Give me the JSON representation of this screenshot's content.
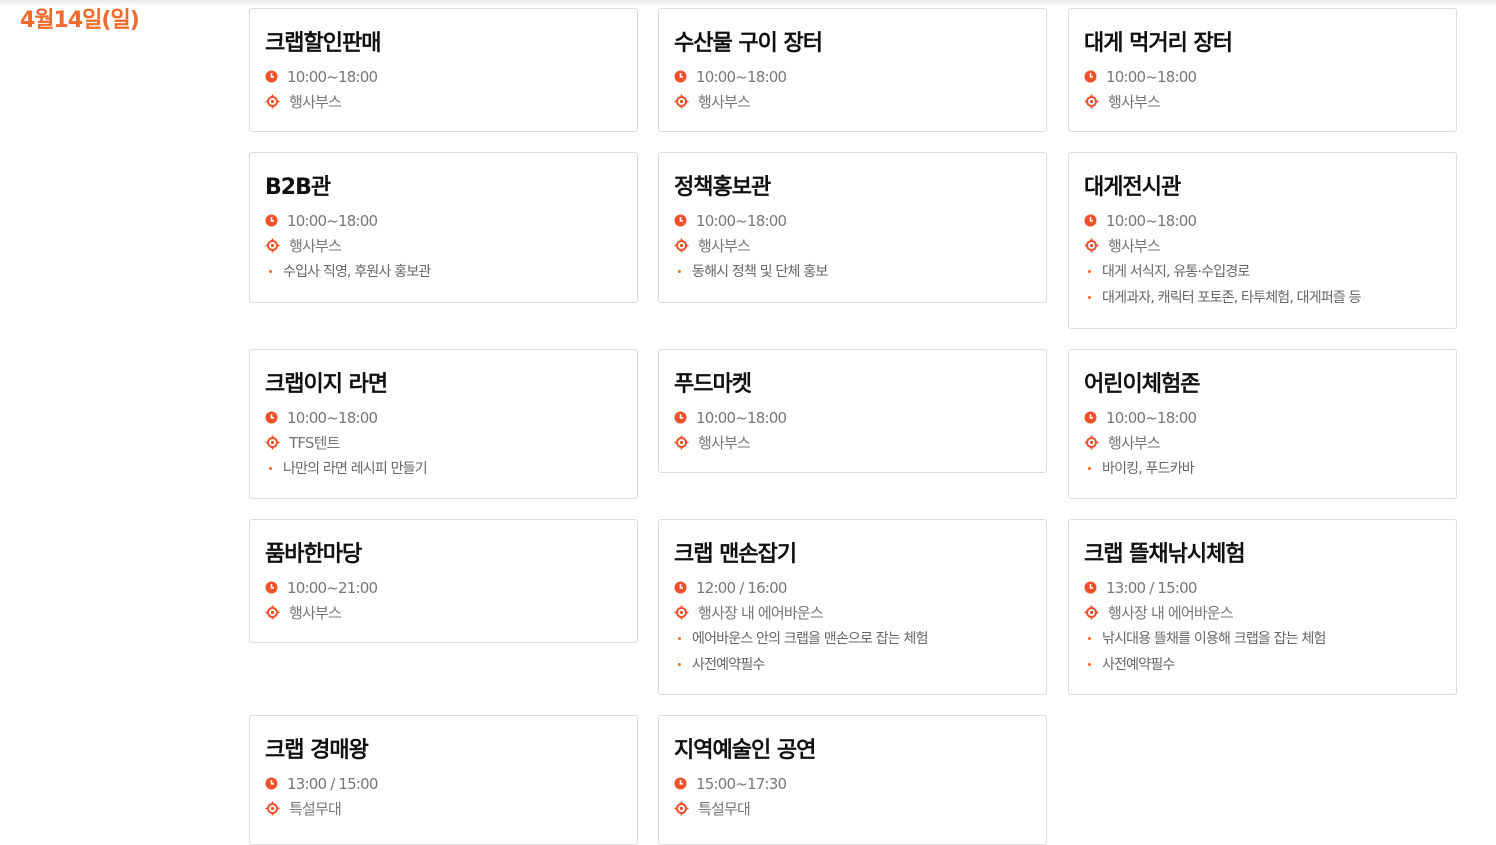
{
  "date_label": "4월14일(일)",
  "accent_color": "#f26b2a",
  "cards": [
    {
      "title": "크랩할인판매",
      "time": "10:00~18:00",
      "place": "행사부스",
      "notes": []
    },
    {
      "title": "수산물 구이 장터",
      "time": "10:00~18:00",
      "place": "행사부스",
      "notes": []
    },
    {
      "title": "대게 먹거리 장터",
      "time": "10:00~18:00",
      "place": "행사부스",
      "notes": []
    },
    {
      "title": "B2B관",
      "time": "10:00~18:00",
      "place": "행사부스",
      "notes": [
        "수입사 직영, 후원사 홍보관"
      ]
    },
    {
      "title": "정책홍보관",
      "time": "10:00~18:00",
      "place": "행사부스",
      "notes": [
        "동해시 정책 및 단체 홍보"
      ]
    },
    {
      "title": "대게전시관",
      "time": "10:00~18:00",
      "place": "행사부스",
      "notes": [
        "대게 서식지, 유통·수입경로",
        "대게과자, 캐릭터 포토존, 타투체험, 대게퍼즐 등"
      ]
    },
    {
      "title": "크랩이지 라면",
      "time": "10:00~18:00",
      "place": "TFS텐트",
      "notes": [
        "나만의 라면 레시피 만들기"
      ]
    },
    {
      "title": "푸드마켓",
      "time": "10:00~18:00",
      "place": "행사부스",
      "notes": []
    },
    {
      "title": "어린이체험존",
      "time": "10:00~18:00",
      "place": "행사부스",
      "notes": [
        "바이킹, 푸드카바"
      ]
    },
    {
      "title": "품바한마당",
      "time": "10:00~21:00",
      "place": "행사부스",
      "notes": []
    },
    {
      "title": "크랩 맨손잡기",
      "time": "12:00 / 16:00",
      "place": "행사장 내 에어바운스",
      "notes": [
        "에어바운스 안의 크랩을 맨손으로 잡는 체험",
        "사전예약필수"
      ]
    },
    {
      "title": "크랩 뜰채낚시체험",
      "time": "13:00 / 15:00",
      "place": "행사장 내 에어바운스",
      "notes": [
        "낚시대용 뜰채를 이용해 크랩을 잡는 체험",
        "사전예약필수"
      ]
    },
    {
      "title": "크랩 경매왕",
      "time": "13:00 / 15:00",
      "place": "특설무대",
      "notes": []
    },
    {
      "title": "지역예술인 공연",
      "time": "15:00~17:30",
      "place": "특설무대",
      "notes": []
    }
  ]
}
